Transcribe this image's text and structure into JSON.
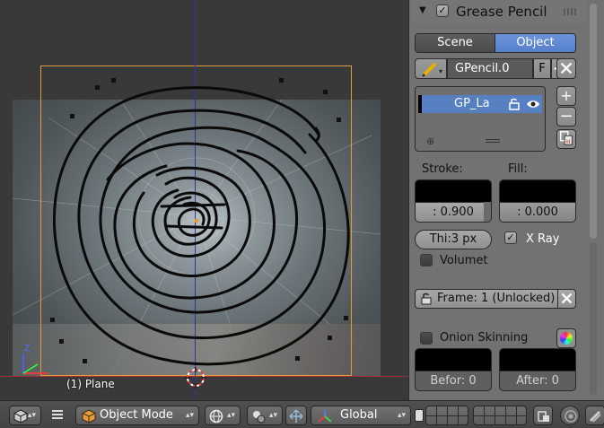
{
  "viewport": {
    "object_label": "(1) Plane",
    "axis_z_label": "Z"
  },
  "panel": {
    "section_title": "Grease Pencil",
    "section_enabled": true,
    "tabs": [
      {
        "label": "Scene",
        "active": false
      },
      {
        "label": "Object",
        "active": true
      }
    ],
    "datablock": {
      "name": "GPencil.0",
      "fake_user_label": "F"
    },
    "layers": [
      {
        "name": "GP_La",
        "active": true
      }
    ],
    "stroke_label": "Stroke:",
    "fill_label": "Fill:",
    "stroke_value": ":  0.900",
    "fill_value": ":  0.000",
    "thickness": "Thi:3 px",
    "xray_label": "X Ray",
    "xray_checked": true,
    "volumetric_label": "Volumet",
    "volumetric_checked": false,
    "frame_label": "Frame: 1 (Unlocked)",
    "onion_label": "Onion Skinning",
    "onion_checked": false,
    "before_value": "Befor: 0",
    "after_value": "After: 0"
  },
  "bottom_bar": {
    "mode": "Object Mode",
    "orientation": "Global"
  },
  "colors": {
    "accent_blue": "#5680c2",
    "frame_orange": "#e49b3a",
    "x_axis": "#a33030",
    "y_axis": "#2f33a8"
  }
}
